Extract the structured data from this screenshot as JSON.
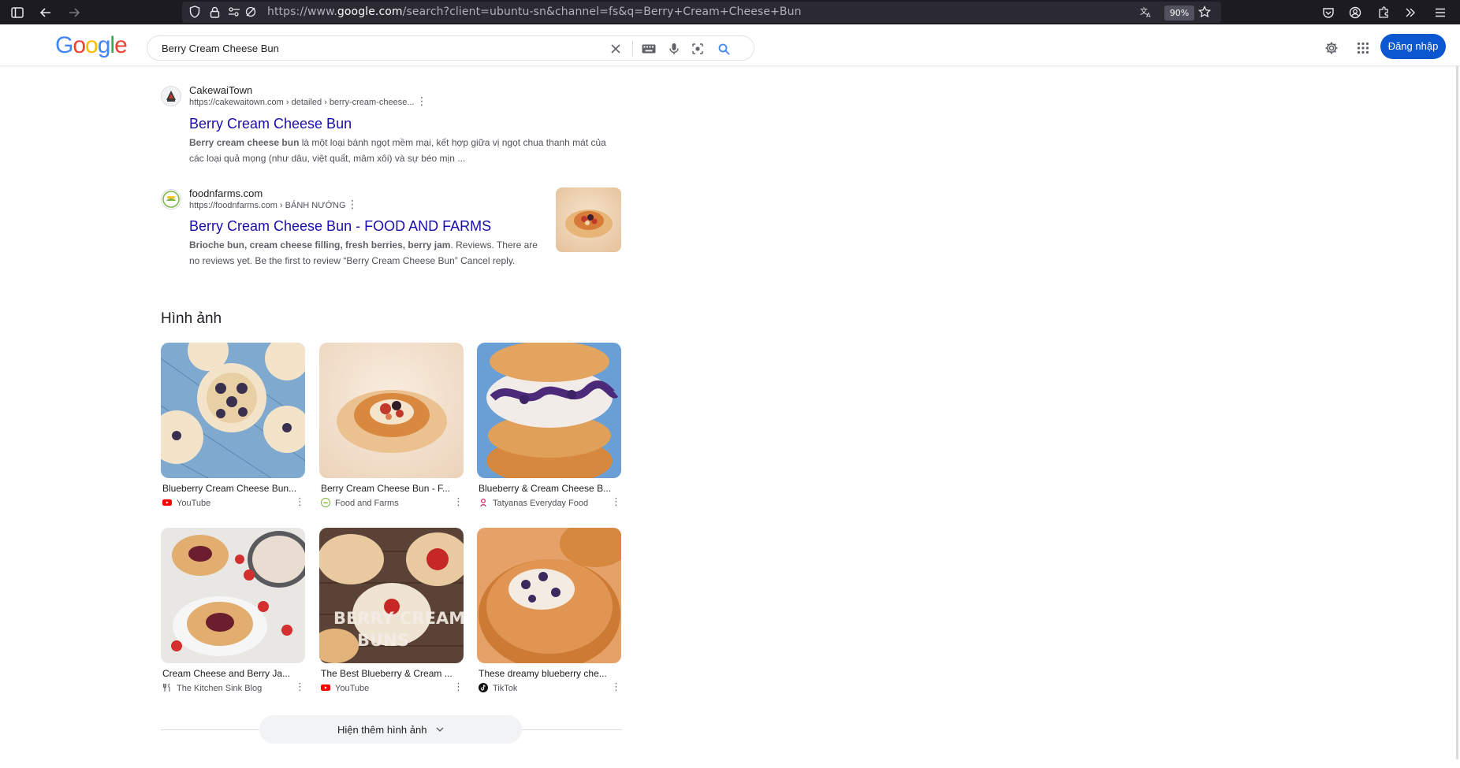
{
  "browser": {
    "url_prefix": "https://www.",
    "url_host": "google.com",
    "url_path": "/search?client=ubuntu-sn&channel=fs&q=Berry+Cream+Cheese+Bun",
    "zoom": "90%"
  },
  "header": {
    "logo_letters": [
      "G",
      "o",
      "o",
      "g",
      "l",
      "e"
    ],
    "search_value": "Berry Cream Cheese Bun",
    "signin_label": "Đăng nhập"
  },
  "results": [
    {
      "site_name": "CakewaiTown",
      "site_url": "https://cakewaitown.com › detailed › berry-cream-cheese...",
      "title": "Berry Cream Cheese Bun",
      "snippet_bold": "Berry cream cheese bun",
      "snippet_rest": " là một loại bánh ngọt mềm mại, kết hợp giữa vị ngọt chua thanh mát của các loại quả mọng (như dâu, việt quất, mâm xôi) và sự béo mịn ..."
    },
    {
      "site_name": "foodnfarms.com",
      "site_url": "https://foodnfarms.com › BÁNH NƯỚNG",
      "title": "Berry Cream Cheese Bun - FOOD AND FARMS",
      "snippet_bold": "Brioche bun, cream cheese filling, fresh berries, berry jam",
      "snippet_rest": ". Reviews. There are no reviews yet. Be the first to review “Berry Cream Cheese Bun” Cancel reply."
    }
  ],
  "images_section": {
    "heading": "Hình ảnh",
    "items": [
      {
        "title": "Blueberry Cream Cheese Bun...",
        "source": "YouTube"
      },
      {
        "title": "Berry Cream Cheese Bun - F...",
        "source": "Food and Farms"
      },
      {
        "title": "Blueberry & Cream Cheese B...",
        "source": "Tatyanas Everyday Food"
      },
      {
        "title": "Cream Cheese and Berry Ja...",
        "source": "The Kitchen Sink Blog"
      },
      {
        "title": "The Best Blueberry & Cream ...",
        "source": "YouTube"
      },
      {
        "title": "These dreamy blueberry che...",
        "source": "TikTok"
      }
    ],
    "overlay_text_line1": "BERRY CREAM",
    "overlay_text_line2": "BUNS",
    "more_label": "Hiện thêm hình ảnh"
  }
}
